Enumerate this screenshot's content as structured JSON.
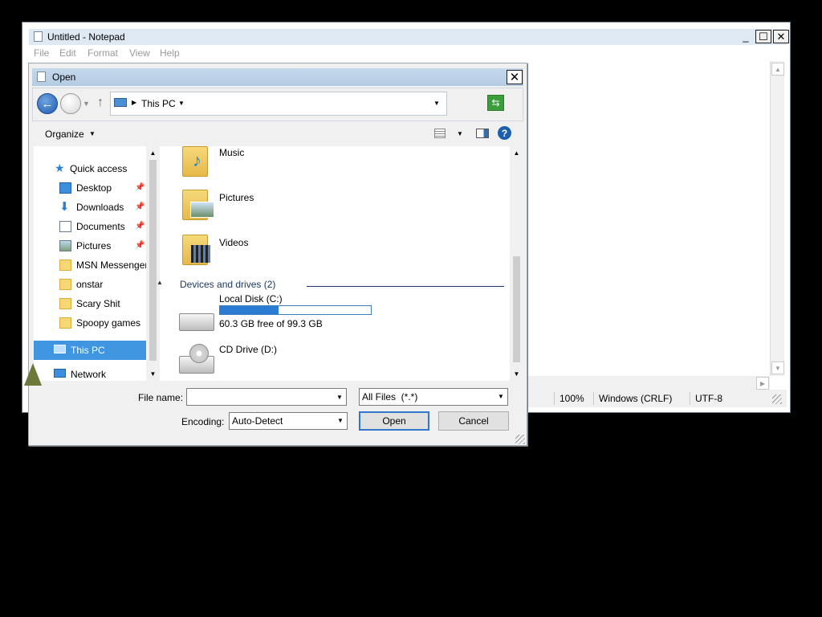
{
  "notepad": {
    "title": "Untitled - Notepad",
    "controls": {
      "minimize": "_",
      "maximize": "☐",
      "close": "✕"
    },
    "menu": [
      "File",
      "Edit",
      "Format",
      "View",
      "Help"
    ],
    "status": {
      "zoom": "100%",
      "line_ending": "Windows (CRLF)",
      "encoding": "UTF-8"
    }
  },
  "dialog": {
    "title": "Open",
    "close": "✕",
    "nav": {
      "back": "←",
      "forward": "→",
      "up": "↑",
      "address": "This PC"
    },
    "toolbar": {
      "organize": "Organize",
      "help": "?"
    },
    "sidebar": {
      "items": [
        {
          "label": "Quick access",
          "icon": "star-icon"
        },
        {
          "label": "Desktop",
          "icon": "desktop-icon",
          "pinned": true
        },
        {
          "label": "Downloads",
          "icon": "download-icon",
          "pinned": true
        },
        {
          "label": "Documents",
          "icon": "document-icon",
          "pinned": true
        },
        {
          "label": "Pictures",
          "icon": "pictures-icon",
          "pinned": true
        },
        {
          "label": "MSN Messenger",
          "icon": "folder-icon"
        },
        {
          "label": "onstar",
          "icon": "folder-icon"
        },
        {
          "label": "Scary Shit",
          "icon": "folder-icon"
        },
        {
          "label": "Spoopy games",
          "icon": "folder-icon"
        },
        {
          "label": "This PC",
          "icon": "computer-icon",
          "selected": true
        },
        {
          "label": "Network",
          "icon": "network-icon"
        }
      ]
    },
    "files": {
      "folders": [
        {
          "label": "Music",
          "icon": "music-folder-icon"
        },
        {
          "label": "Pictures",
          "icon": "pictures-folder-icon"
        },
        {
          "label": "Videos",
          "icon": "videos-folder-icon"
        }
      ],
      "group_header": "Devices and drives (2)",
      "drives": [
        {
          "label": "Local Disk (C:)",
          "free_text": "60.3 GB free of 99.3 GB",
          "used_fraction": 0.39,
          "icon": "hard-disk-icon"
        },
        {
          "label": "CD Drive (D:)",
          "icon": "cd-drive-icon"
        }
      ]
    },
    "bottom": {
      "file_name_label": "File name:",
      "file_name_value": "",
      "filter": "All Files  (*.*)",
      "encoding_label": "Encoding:",
      "encoding_value": "Auto-Detect",
      "open": "Open",
      "cancel": "Cancel"
    }
  },
  "colors": {
    "selection": "#3f95e0",
    "accent": "#2b7bd2"
  }
}
